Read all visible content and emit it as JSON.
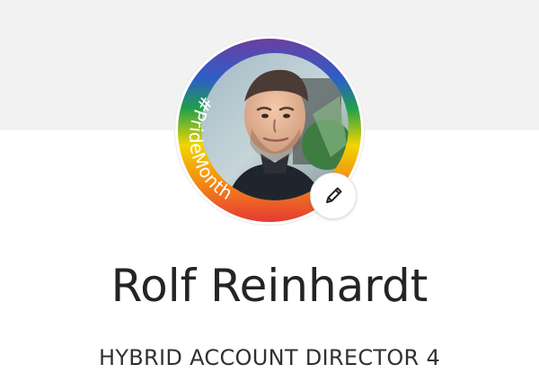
{
  "profile": {
    "name": "Rolf Reinhardt",
    "job_title": "HYBRID ACCOUNT DIRECTOR 4",
    "frame_text": "#PrideMonth",
    "avatar_icon": "profile-photo-avatar",
    "edit_icon": "pencil-icon"
  },
  "colors": {
    "header_band": "#f2f2f2",
    "name_text": "#252423",
    "title_text": "#323130",
    "pride_frame": [
      "#6b3fa0",
      "#2d5ec8",
      "#1f9f4b",
      "#f1d500",
      "#f48b14",
      "#e53935"
    ]
  }
}
